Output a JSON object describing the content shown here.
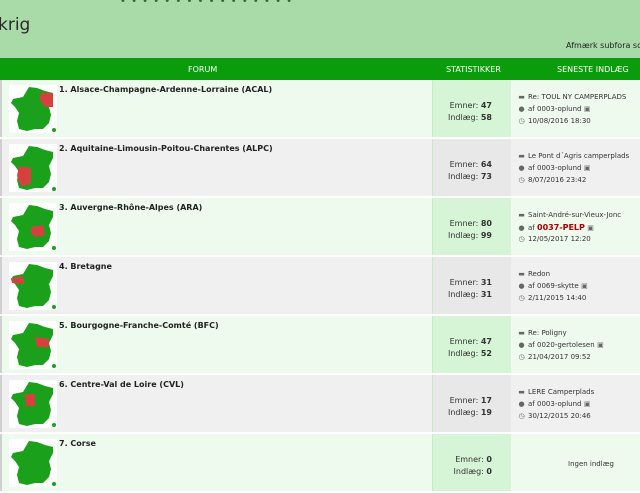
{
  "banner": {
    "title": "krig",
    "subforum_link": "Afmærk subfora so",
    "top_dots": "• •  • •  • •  •  • • • • •  •  • •  •"
  },
  "table_head": {
    "forum": "FORUM",
    "stats": "STATISTIKKER",
    "latest": "SENESTE INDLÆG"
  },
  "labels": {
    "topics": "Emner:",
    "posts": "Indlæg:",
    "by": "af",
    "no_posts": "Ingen indlæg"
  },
  "colors": {
    "header_green": "#0b9c0b",
    "banner_green": "#a8dba8",
    "map_green": "#1aa01a",
    "map_red": "#d84040",
    "user_red": "#a00000"
  },
  "forums": [
    {
      "name": "1. Alsace-Champagne-Ardenne-Lorraine (ACAL)",
      "topics": "47",
      "posts": "58",
      "latest": {
        "title": "Re: TOUL NY CAMPERPLADS",
        "user": "0003-oplund",
        "date": "10/08/2016 18:30"
      },
      "region": "ne"
    },
    {
      "name": "2. Aquitaine-Limousin-Poitou-Charentes (ALPC)",
      "topics": "64",
      "posts": "73",
      "latest": {
        "title": "Le Pont d´Agris camperplads",
        "user": "0003-oplund",
        "date": "8/07/2016 23:42"
      },
      "region": "sw"
    },
    {
      "name": "3. Auvergne-Rhône-Alpes (ARA)",
      "topics": "80",
      "posts": "99",
      "latest": {
        "title": "Saint-André-sur-Vieux-Jonc",
        "user": "0037-PELP",
        "date": "12/05/2017 12:20"
      },
      "region": "se"
    },
    {
      "name": "4. Bretagne",
      "topics": "31",
      "posts": "31",
      "latest": {
        "title": "Redon",
        "user": "0069-skytte",
        "date": "2/11/2015 14:40"
      },
      "region": "w"
    },
    {
      "name": "5. Bourgogne-Franche-Comté (BFC)",
      "topics": "47",
      "posts": "52",
      "latest": {
        "title": "Re: Poligny",
        "user": "0020-gertolesen",
        "date": "21/04/2017 09:52"
      },
      "region": "e"
    },
    {
      "name": "6. Centre-Val de Loire (CVL)",
      "topics": "17",
      "posts": "19",
      "latest": {
        "title": "LERE Camperplads",
        "user": "0003-oplund",
        "date": "30/12/2015 20:46"
      },
      "region": "c"
    },
    {
      "name": "7. Corse",
      "topics": "0",
      "posts": "0",
      "latest": null,
      "region": "none"
    }
  ]
}
